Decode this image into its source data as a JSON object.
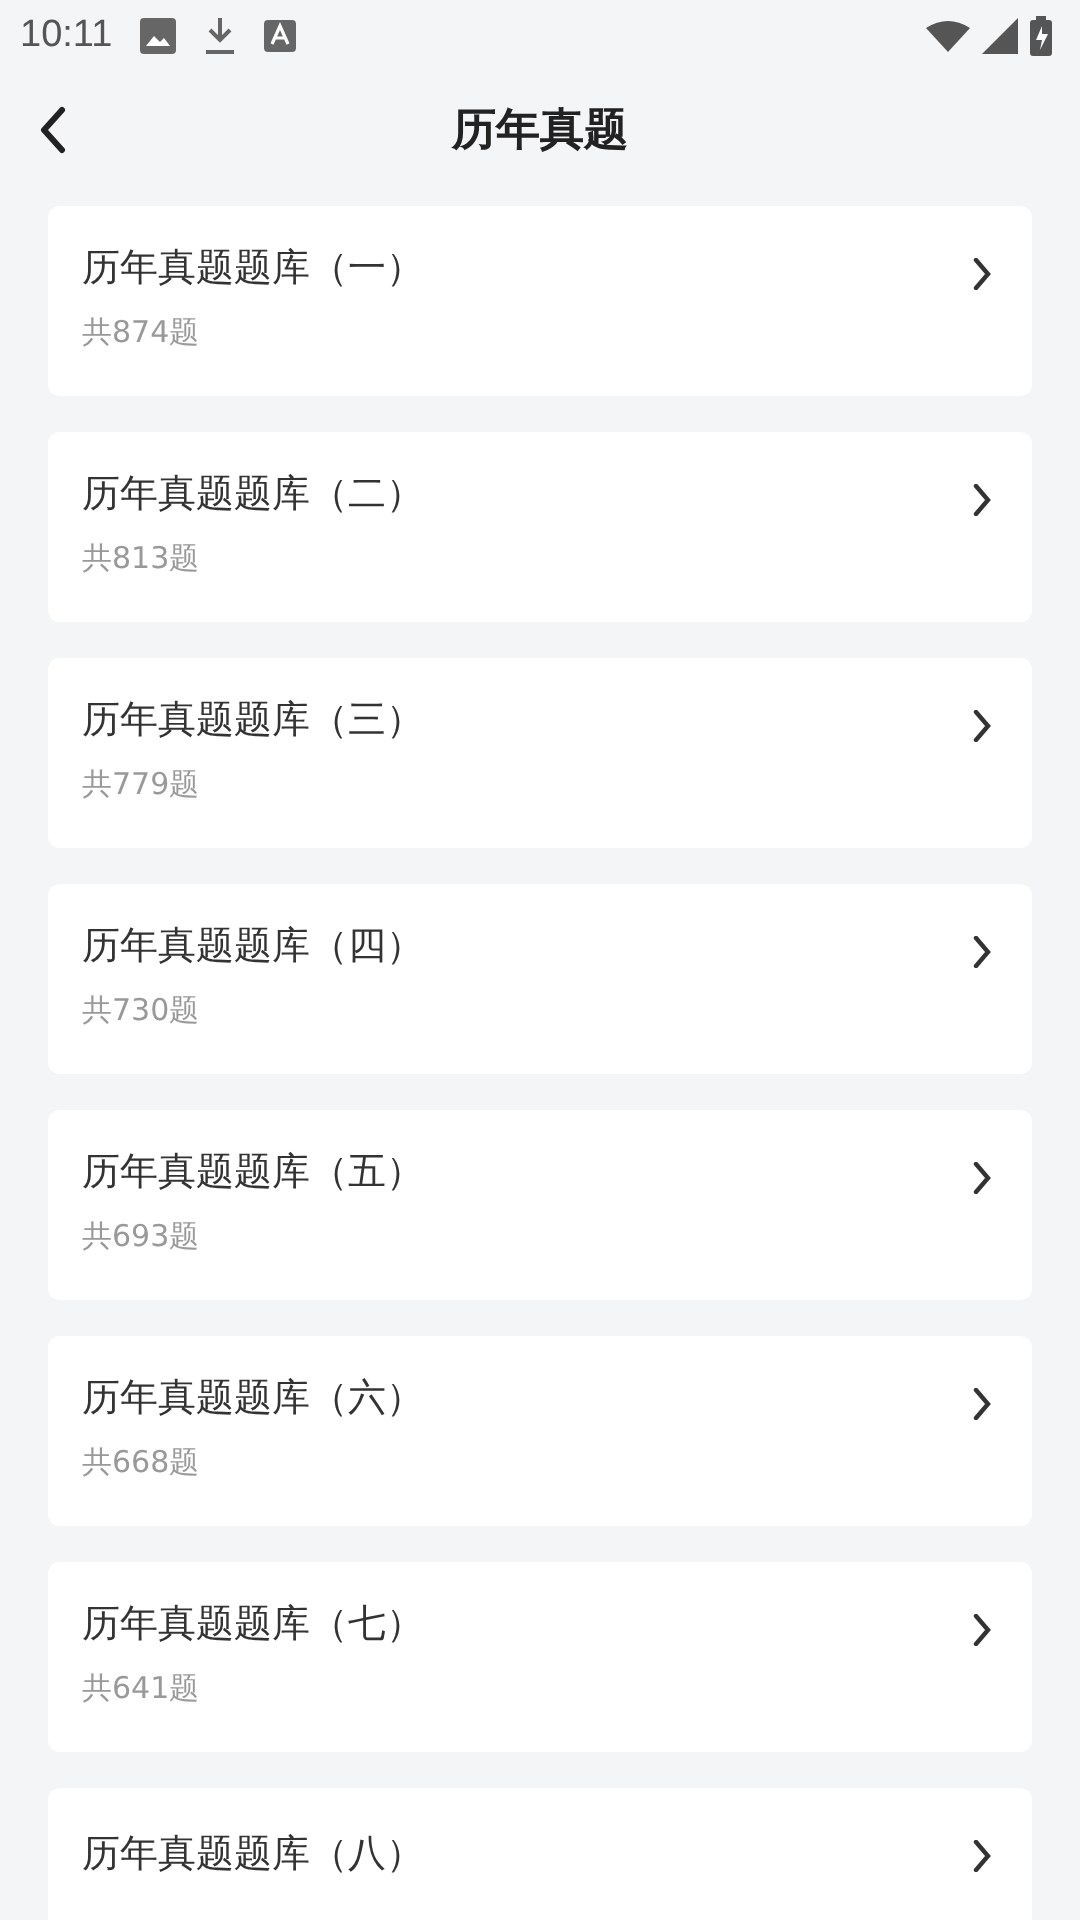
{
  "status_bar": {
    "time": "10:11"
  },
  "header": {
    "title": "历年真题"
  },
  "banks": [
    {
      "title": "历年真题题库（一）",
      "count": "共874题"
    },
    {
      "title": "历年真题题库（二）",
      "count": "共813题"
    },
    {
      "title": "历年真题题库（三）",
      "count": "共779题"
    },
    {
      "title": "历年真题题库（四）",
      "count": "共730题"
    },
    {
      "title": "历年真题题库（五）",
      "count": "共693题"
    },
    {
      "title": "历年真题题库（六）",
      "count": "共668题"
    },
    {
      "title": "历年真题题库（七）",
      "count": "共641题"
    },
    {
      "title": "历年真题题库（八）"
    }
  ]
}
